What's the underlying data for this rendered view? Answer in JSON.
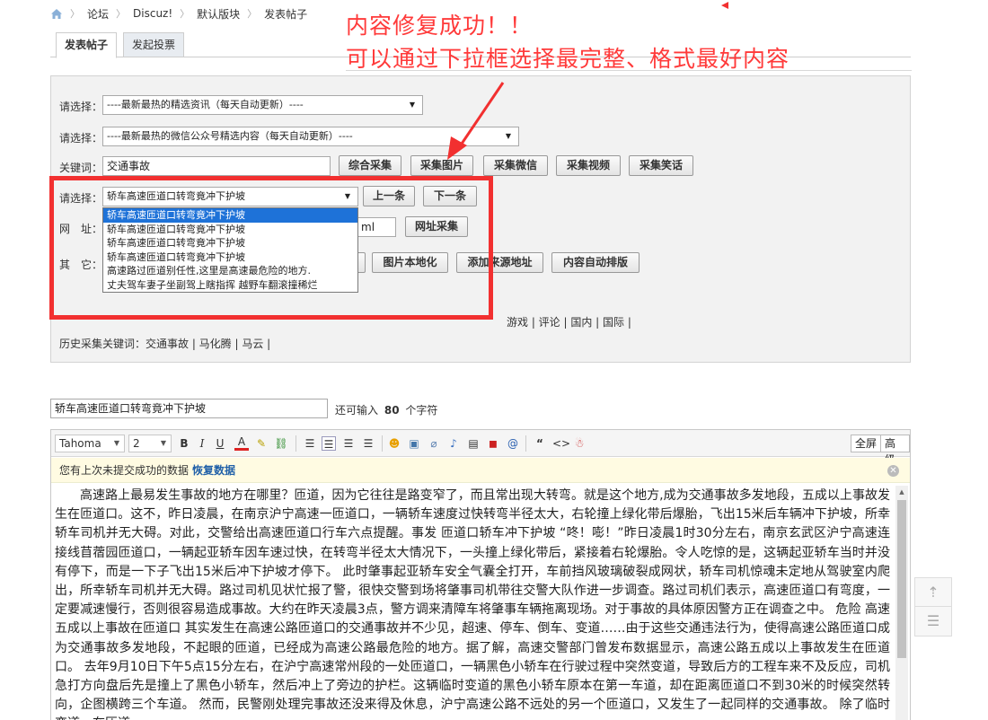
{
  "breadcrumb": {
    "items": [
      "论坛",
      "Discuz!",
      "默认版块",
      "发表帖子"
    ]
  },
  "tabs": [
    {
      "label": "发表帖子"
    },
    {
      "label": "发起投票"
    }
  ],
  "annotation": {
    "line1": "内容修复成功！！",
    "line2": "可以通过下拉框选择最完整、格式最好内容"
  },
  "collector": {
    "select1": {
      "label": "请选择：",
      "value": "----最新最热的精选资讯（每天自动更新）----"
    },
    "select2": {
      "label": "请选择：",
      "value": "----最新最热的微信公众号精选内容（每天自动更新）----"
    },
    "keyword": {
      "label": "关键词：",
      "value": "交通事故"
    },
    "collect_buttons": [
      "综合采集",
      "采集图片",
      "采集微信",
      "采集视频",
      "采集笑话"
    ],
    "select3": {
      "label": "请选择：",
      "value": "轿车高速匝道口转弯竟冲下护坡"
    },
    "prev_button": "上一条",
    "next_button": "下一条",
    "url": {
      "label": "网　址：",
      "value_tail": "ml"
    },
    "url_button": "网址采集",
    "other_label": "其　它：",
    "other_buttons": [
      "图片本地化",
      "添加来源地址",
      "内容自动排版"
    ],
    "dropdown_options": [
      "轿车高速匝道口转弯竟冲下护坡",
      "轿车高速匝道口转弯竟冲下护坡",
      "轿车高速匝道口转弯竟冲下护坡",
      "轿车高速匝道口转弯竟冲下护坡",
      "高速路过匝道别任性,这里是高速最危险的地方.",
      "丈夫驾车妻子坐副驾上瞎指挥 越野车翻滚撞稀烂"
    ],
    "common_keywords_visible": "游戏 | 评论 | 国内 | 国际 |",
    "history_keywords": "历史采集关键词：交通事故 | 马化腾 | 马云 |"
  },
  "post": {
    "title": "轿车高速匝道口转弯竟冲下护坡",
    "remaining_prefix": "还可输入",
    "remaining_count": "80",
    "remaining_suffix": "个字符"
  },
  "editor": {
    "font": "Tahoma",
    "size": "2",
    "fullscreen_label": "全屏",
    "advanced_label": "高级",
    "notice_text": "您有上次未提交成功的数据",
    "restore_label": "恢复数据",
    "body": "高速路上最易发生事故的地方在哪里？匝道，因为它往往是路变窄了，而且常出现大转弯。就是这个地方,成为交通事故多发地段，五成以上事故发生在匝道口。这不，昨日凌晨，在南京沪宁高速一匝道口，一辆轿车速度过快转弯半径太大，右轮撞上绿化带后爆胎，飞出15米后车辆冲下护坡，所幸轿车司机并无大碍。对此，交警给出高速匝道口行车六点提醒。事发 匝道口轿车冲下护坡 “咚！嘭！”昨日凌晨1时30分左右，南京玄武区沪宁高速连接线苜蓿园匝道口，一辆起亚轿车因车速过快，在转弯半径太大情况下，一头撞上绿化带后，紧接着右轮爆胎。令人吃惊的是，这辆起亚轿车当时并没有停下，而是一下子飞出15米后冲下护坡才停下。 此时肇事起亚轿车安全气囊全打开，车前挡风玻璃破裂成网状，轿车司机惊魂未定地从驾驶室内爬出，所幸轿车司机并无大碍。路过司机见状忙报了警，很快交警到场将肇事司机带往交警大队作进一步调查。路过司机们表示，高速匝道口有弯度，一定要减速慢行，否则很容易造成事故。大约在昨天凌晨3点，警方调来清障车将肇事车辆拖离现场。对于事故的具体原因警方正在调查之中。 危险 高速五成以上事故在匝道口 其实发生在高速公路匝道口的交通事故并不少见，超速、停车、倒车、变道……由于这些交通违法行为，使得高速公路匝道口成为交通事故多发地段，不起眼的匝道，已经成为高速公路最危险的地方。据了解，高速交警部门曾发布数据显示，高速公路五成以上事故发生在匝道口。 去年9月10日下午5点15分左右，在沪宁高速常州段的一处匝道口，一辆黑色小轿车在行驶过程中突然变道，导致后方的工程车来不及反应，司机急打方向盘后先是撞上了黑色小轿车，然后冲上了旁边的护栏。这辆临时变道的黑色小轿车原本在第一车道，却在距离匝道口不到30米的时候突然转向，企图横跨三个车道。 然而，民警刚处理完事故还没来得及休息，沪宁高速公路不远处的另一个匝道口，又发生了一起同样的交通事故。 除了临时变道，在匝道"
  }
}
